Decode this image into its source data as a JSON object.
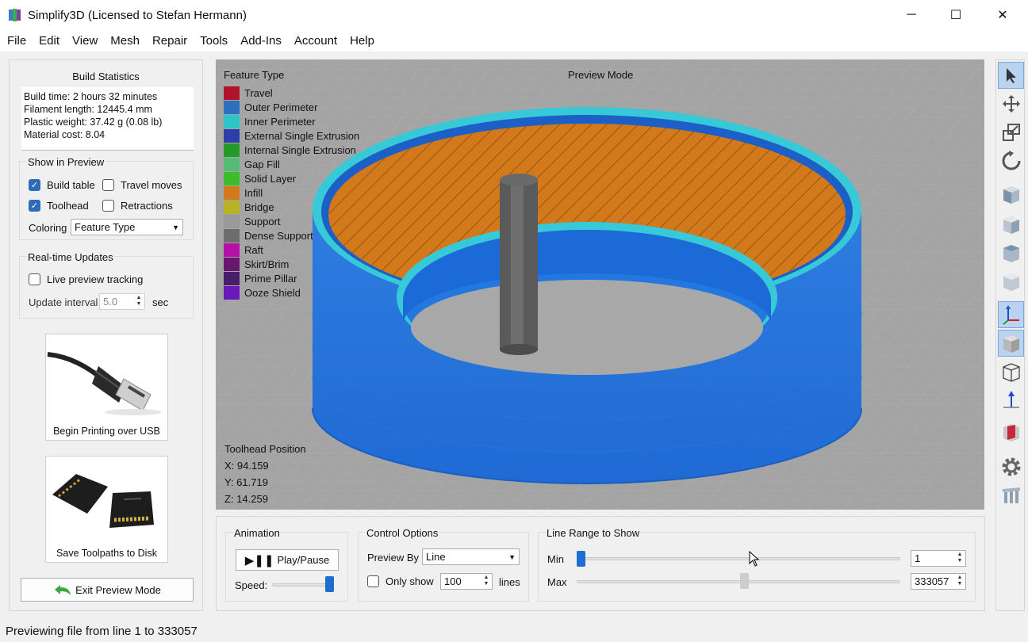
{
  "window": {
    "title": "Simplify3D (Licensed to Stefan Hermann)",
    "minimize": "─",
    "maximize": "☐",
    "close": "✕"
  },
  "menu": [
    "File",
    "Edit",
    "View",
    "Mesh",
    "Repair",
    "Tools",
    "Add-Ins",
    "Account",
    "Help"
  ],
  "build_stats": {
    "title": "Build Statistics",
    "lines": [
      "Build time: 2 hours 32 minutes",
      "Filament length: 12445.4 mm",
      "Plastic weight: 37.42 g (0.08 lb)",
      "Material cost: 8.04"
    ]
  },
  "show_in_preview": {
    "title": "Show in Preview",
    "build_table": {
      "label": "Build table",
      "checked": true
    },
    "travel_moves": {
      "label": "Travel moves",
      "checked": false
    },
    "toolhead": {
      "label": "Toolhead",
      "checked": true
    },
    "retractions": {
      "label": "Retractions",
      "checked": false
    },
    "coloring_label": "Coloring",
    "coloring_value": "Feature Type"
  },
  "realtime": {
    "title": "Real-time Updates",
    "live_label": "Live preview tracking",
    "live_checked": false,
    "interval_label": "Update interval",
    "interval_value": "5.0",
    "interval_unit": "sec"
  },
  "tiles": {
    "usb_label": "Begin Printing over USB",
    "sd_label": "Save Toolpaths to Disk"
  },
  "exit_button": "Exit Preview Mode",
  "viewport": {
    "legend_title": "Feature Type",
    "mode": "Preview Mode",
    "legend": [
      {
        "label": "Travel",
        "color": "#b0132b"
      },
      {
        "label": "Outer Perimeter",
        "color": "#2f6fc0"
      },
      {
        "label": "Inner Perimeter",
        "color": "#2dc6c6"
      },
      {
        "label": "External Single Extrusion",
        "color": "#2c3fa8"
      },
      {
        "label": "Internal Single Extrusion",
        "color": "#249a2a"
      },
      {
        "label": "Gap Fill",
        "color": "#55bb77"
      },
      {
        "label": "Solid Layer",
        "color": "#3cbd2a"
      },
      {
        "label": "Infill",
        "color": "#d2791c"
      },
      {
        "label": "Bridge",
        "color": "#b8b226"
      },
      {
        "label": "Support",
        "color": "#9a9a9a"
      },
      {
        "label": "Dense Support",
        "color": "#6d6d6d"
      },
      {
        "label": "Raft",
        "color": "#b412a5"
      },
      {
        "label": "Skirt/Brim",
        "color": "#6a1570"
      },
      {
        "label": "Prime Pillar",
        "color": "#4a1c6c"
      },
      {
        "label": "Ooze Shield",
        "color": "#6a18b8"
      }
    ],
    "toolhead_title": "Toolhead Position",
    "x": "X: 94.159",
    "y": "Y: 61.719",
    "z": "Z: 14.259"
  },
  "animation": {
    "title": "Animation",
    "play_label": "Play/Pause",
    "speed_label": "Speed:",
    "speed_fraction": 1.0
  },
  "control_options": {
    "title": "Control Options",
    "preview_by_label": "Preview By",
    "preview_by_value": "Line",
    "only_show_label": "Only show",
    "only_show_checked": false,
    "only_show_value": "100",
    "lines_label": "lines"
  },
  "line_range": {
    "title": "Line Range to Show",
    "min_label": "Min",
    "max_label": "Max",
    "min_value": "1",
    "max_value": "333057",
    "min_fraction": 0.0,
    "max_fraction": 0.52
  },
  "toolbar_icons": [
    "select-arrow-icon",
    "move-icon",
    "scale-icon",
    "rotate-icon",
    "view-iso-icon",
    "view-front-icon",
    "view-top-icon",
    "view-side-icon",
    "axes-icon",
    "solid-cube-icon",
    "wireframe-cube-icon",
    "normal-arrow-icon",
    "cross-section-icon",
    "settings-gear-icon",
    "supports-icon"
  ],
  "status": "Previewing file from line 1 to 333057"
}
